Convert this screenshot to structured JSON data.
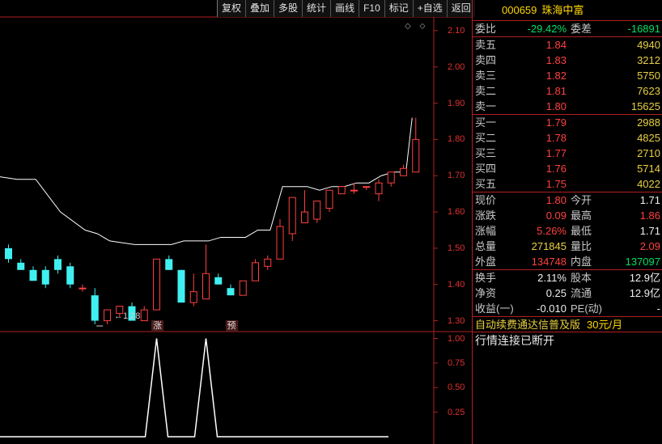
{
  "toolbar": [
    "复权",
    "叠加",
    "多股",
    "统计",
    "画线",
    "F10",
    "标记",
    "+自选",
    "返回"
  ],
  "toolbar_icons": "◇ ⬦",
  "stock": {
    "code": "000659",
    "name": "珠海中富"
  },
  "weibi": {
    "label": "委比",
    "value": "-29.42%",
    "label2": "委差",
    "value2": "-16891"
  },
  "sells": [
    {
      "label": "卖五",
      "price": "1.84",
      "vol": "4940"
    },
    {
      "label": "卖四",
      "price": "1.83",
      "vol": "3212"
    },
    {
      "label": "卖三",
      "price": "1.82",
      "vol": "5750"
    },
    {
      "label": "卖二",
      "price": "1.81",
      "vol": "7623"
    },
    {
      "label": "卖一",
      "price": "1.80",
      "vol": "15625"
    }
  ],
  "buys": [
    {
      "label": "买一",
      "price": "1.79",
      "vol": "2988"
    },
    {
      "label": "买二",
      "price": "1.78",
      "vol": "4825"
    },
    {
      "label": "买三",
      "price": "1.77",
      "vol": "2710"
    },
    {
      "label": "买四",
      "price": "1.76",
      "vol": "5714"
    },
    {
      "label": "买五",
      "price": "1.75",
      "vol": "4022"
    }
  ],
  "quote": [
    {
      "l1": "现价",
      "v1": "1.80",
      "c1": "red",
      "l2": "今开",
      "v2": "1.71",
      "c2": "white"
    },
    {
      "l1": "涨跌",
      "v1": "0.09",
      "c1": "red",
      "l2": "最高",
      "v2": "1.86",
      "c2": "red"
    },
    {
      "l1": "涨幅",
      "v1": "5.26%",
      "c1": "red",
      "l2": "最低",
      "v2": "1.71",
      "c2": "white"
    },
    {
      "l1": "总量",
      "v1": "271845",
      "c1": "yellow",
      "l2": "量比",
      "v2": "2.09",
      "c2": "red"
    },
    {
      "l1": "外盘",
      "v1": "134748",
      "c1": "red",
      "l2": "内盘",
      "v2": "137097",
      "c2": "green"
    }
  ],
  "fund": [
    {
      "l1": "换手",
      "v1": "2.11%",
      "l2": "股本",
      "v2": "12.9亿"
    },
    {
      "l1": "净资",
      "v1": "0.25",
      "l2": "流通",
      "v2": "12.9亿"
    },
    {
      "l1": "收益(一)",
      "v1": "-0.010",
      "l2": "PE(动)",
      "v2": "-"
    }
  ],
  "promo": {
    "text": "自动续费通达信普及版",
    "price": "30元/月"
  },
  "status": "行情连接已断开",
  "chart": {
    "low_label": "1.28",
    "markers": [
      {
        "text": "涨",
        "index": 12
      },
      {
        "text": "预",
        "index": 18
      }
    ],
    "price_ticks": [
      "2.10",
      "2.00",
      "1.90",
      "1.80",
      "1.70",
      "1.60",
      "1.50",
      "1.40",
      "1.30"
    ],
    "ind_ticks": [
      "1.00",
      "0.75",
      "0.50",
      "0.25"
    ],
    "colors": {
      "up": "#ff4040",
      "down": "#40f0f0",
      "line": "#ffffff",
      "axis": "#b02020"
    }
  },
  "chart_data": {
    "type": "candlestick",
    "price_range": [
      1.27,
      2.14
    ],
    "candles": [
      {
        "o": 1.5,
        "h": 1.51,
        "l": 1.46,
        "c": 1.47
      },
      {
        "o": 1.46,
        "h": 1.47,
        "l": 1.44,
        "c": 1.44
      },
      {
        "o": 1.44,
        "h": 1.45,
        "l": 1.41,
        "c": 1.41
      },
      {
        "o": 1.44,
        "h": 1.45,
        "l": 1.39,
        "c": 1.4
      },
      {
        "o": 1.47,
        "h": 1.48,
        "l": 1.43,
        "c": 1.44
      },
      {
        "o": 1.45,
        "h": 1.46,
        "l": 1.39,
        "c": 1.4
      },
      {
        "o": 1.39,
        "h": 1.4,
        "l": 1.38,
        "c": 1.39
      },
      {
        "o": 1.37,
        "h": 1.39,
        "l": 1.29,
        "c": 1.3
      },
      {
        "o": 1.3,
        "h": 1.33,
        "l": 1.29,
        "c": 1.33
      },
      {
        "o": 1.32,
        "h": 1.34,
        "l": 1.31,
        "c": 1.34
      },
      {
        "o": 1.34,
        "h": 1.35,
        "l": 1.3,
        "c": 1.3
      },
      {
        "o": 1.3,
        "h": 1.34,
        "l": 1.3,
        "c": 1.33
      },
      {
        "o": 1.33,
        "h": 1.47,
        "l": 1.33,
        "c": 1.47
      },
      {
        "o": 1.47,
        "h": 1.48,
        "l": 1.44,
        "c": 1.44
      },
      {
        "o": 1.44,
        "h": 1.44,
        "l": 1.35,
        "c": 1.35
      },
      {
        "o": 1.35,
        "h": 1.43,
        "l": 1.34,
        "c": 1.38
      },
      {
        "o": 1.36,
        "h": 1.51,
        "l": 1.36,
        "c": 1.43
      },
      {
        "o": 1.42,
        "h": 1.43,
        "l": 1.4,
        "c": 1.4
      },
      {
        "o": 1.39,
        "h": 1.4,
        "l": 1.37,
        "c": 1.37
      },
      {
        "o": 1.37,
        "h": 1.41,
        "l": 1.37,
        "c": 1.41
      },
      {
        "o": 1.41,
        "h": 1.47,
        "l": 1.41,
        "c": 1.46
      },
      {
        "o": 1.45,
        "h": 1.48,
        "l": 1.44,
        "c": 1.47
      },
      {
        "o": 1.47,
        "h": 1.58,
        "l": 1.47,
        "c": 1.56
      },
      {
        "o": 1.54,
        "h": 1.64,
        "l": 1.52,
        "c": 1.64
      },
      {
        "o": 1.57,
        "h": 1.66,
        "l": 1.57,
        "c": 1.6
      },
      {
        "o": 1.58,
        "h": 1.63,
        "l": 1.57,
        "c": 1.63
      },
      {
        "o": 1.61,
        "h": 1.66,
        "l": 1.6,
        "c": 1.66
      },
      {
        "o": 1.65,
        "h": 1.67,
        "l": 1.65,
        "c": 1.67
      },
      {
        "o": 1.66,
        "h": 1.68,
        "l": 1.65,
        "c": 1.66
      },
      {
        "o": 1.67,
        "h": 1.67,
        "l": 1.66,
        "c": 1.67
      },
      {
        "o": 1.65,
        "h": 1.69,
        "l": 1.63,
        "c": 1.68
      },
      {
        "o": 1.68,
        "h": 1.71,
        "l": 1.67,
        "c": 1.71
      },
      {
        "o": 1.7,
        "h": 1.73,
        "l": 1.7,
        "c": 1.72
      },
      {
        "o": 1.71,
        "h": 1.86,
        "l": 1.71,
        "c": 1.8
      }
    ],
    "line": [
      {
        "x": -1,
        "y": 1.7
      },
      {
        "x": 1,
        "y": 1.69
      },
      {
        "x": 2.5,
        "y": 1.69
      },
      {
        "x": 4.5,
        "y": 1.6
      },
      {
        "x": 6.5,
        "y": 1.55
      },
      {
        "x": 7.5,
        "y": 1.54
      },
      {
        "x": 8.5,
        "y": 1.52
      },
      {
        "x": 10.5,
        "y": 1.51
      },
      {
        "x": 13.5,
        "y": 1.51
      },
      {
        "x": 14.5,
        "y": 1.52
      },
      {
        "x": 16.5,
        "y": 1.52
      },
      {
        "x": 17.5,
        "y": 1.53
      },
      {
        "x": 19.5,
        "y": 1.53
      },
      {
        "x": 20.5,
        "y": 1.55
      },
      {
        "x": 21.5,
        "y": 1.55
      },
      {
        "x": 22.5,
        "y": 1.67
      },
      {
        "x": 24.5,
        "y": 1.67
      },
      {
        "x": 25.5,
        "y": 1.66
      },
      {
        "x": 26.5,
        "y": 1.67
      },
      {
        "x": 27.5,
        "y": 1.67
      },
      {
        "x": 28.5,
        "y": 1.68
      },
      {
        "x": 29.5,
        "y": 1.68
      },
      {
        "x": 30.5,
        "y": 1.7
      },
      {
        "x": 31.5,
        "y": 1.71
      },
      {
        "x": 32.5,
        "y": 1.71
      },
      {
        "x": 33.0,
        "y": 1.86
      }
    ],
    "indicator": [
      {
        "x": 12,
        "y": 1.0
      },
      {
        "x": 16,
        "y": 1.0
      }
    ],
    "indicator_range": [
      0,
      1.07
    ]
  }
}
